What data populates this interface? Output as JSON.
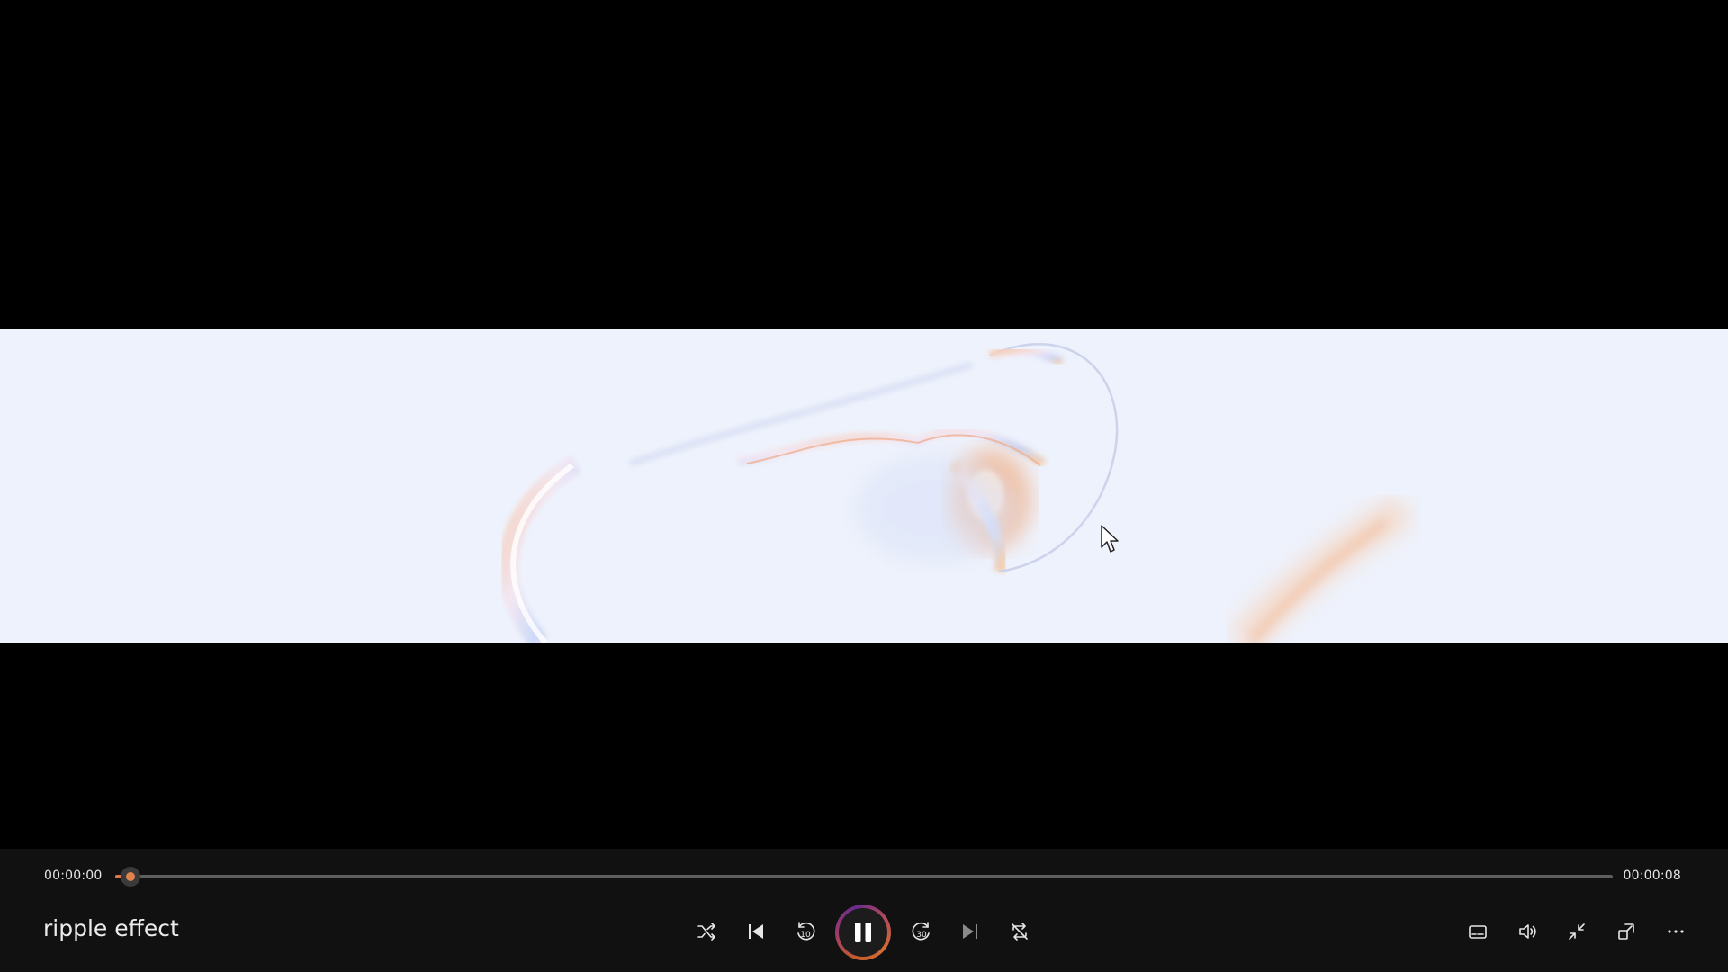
{
  "video": {
    "title": "ripple effect"
  },
  "playback": {
    "current_time": "00:00:00",
    "total_time": "00:00:08",
    "progress": 0.01,
    "state": "playing"
  },
  "controls": {
    "center": [
      {
        "name": "shuffle",
        "icon": "shuffle-icon"
      },
      {
        "name": "previous",
        "icon": "previous-track-icon"
      },
      {
        "name": "skip-back",
        "icon": "skip-back-10-icon",
        "label": "10"
      },
      {
        "name": "pause",
        "icon": "pause-icon"
      },
      {
        "name": "skip-forward",
        "icon": "skip-forward-30-icon",
        "label": "30"
      },
      {
        "name": "next",
        "icon": "next-track-icon"
      },
      {
        "name": "repeat",
        "icon": "repeat-off-icon"
      }
    ],
    "right": [
      {
        "name": "captions",
        "icon": "captions-icon"
      },
      {
        "name": "volume",
        "icon": "volume-icon"
      },
      {
        "name": "exit-fullscreen",
        "icon": "exit-fullscreen-icon"
      },
      {
        "name": "mini-view",
        "icon": "mini-view-icon"
      },
      {
        "name": "more",
        "icon": "more-options-icon"
      }
    ]
  },
  "colors": {
    "accent": "#e0834f",
    "bar_background": "#111111",
    "video_background": "#eef2fc"
  }
}
